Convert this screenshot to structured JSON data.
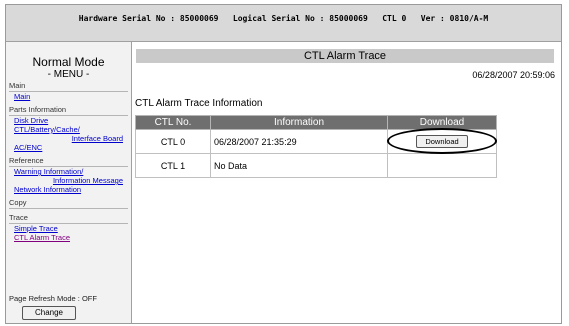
{
  "header": {
    "hardware_serial_label": "Hardware Serial No : 85000069",
    "logical_serial_label": "Logical Serial No : 85000069",
    "ctl": "CTL 0",
    "version": "Ver : 0810/A-M"
  },
  "sidebar": {
    "mode": "Normal Mode",
    "menu": "- MENU -",
    "sections": {
      "main": "Main",
      "parts": "Parts Information",
      "reference": "Reference",
      "copy": "Copy",
      "trace": "Trace"
    },
    "links": {
      "main": "Main",
      "disk_drive": "Disk Drive",
      "ctl_battery_1": "CTL/Battery/Cache/",
      "ctl_battery_2": "Interface Board",
      "ac_enc": "AC/ENC",
      "warning_1": "Warning Information/",
      "warning_2": "Information Message",
      "network": "Network Information",
      "simple_trace": "Simple Trace",
      "ctl_alarm_trace": "CTL Alarm Trace"
    },
    "refresh_mode": "Page Refresh Mode : OFF",
    "change_button": "Change"
  },
  "main": {
    "page_title": "CTL Alarm Trace",
    "timestamp": "06/28/2007 20:59:06",
    "section_title": "CTL Alarm Trace Information",
    "table": {
      "headers": [
        "CTL No.",
        "Information",
        "Download"
      ],
      "rows": [
        {
          "ctl": "CTL 0",
          "info": "06/28/2007 21:35:29",
          "download": "Download"
        },
        {
          "ctl": "CTL 1",
          "info": "No Data",
          "download": ""
        }
      ]
    }
  }
}
